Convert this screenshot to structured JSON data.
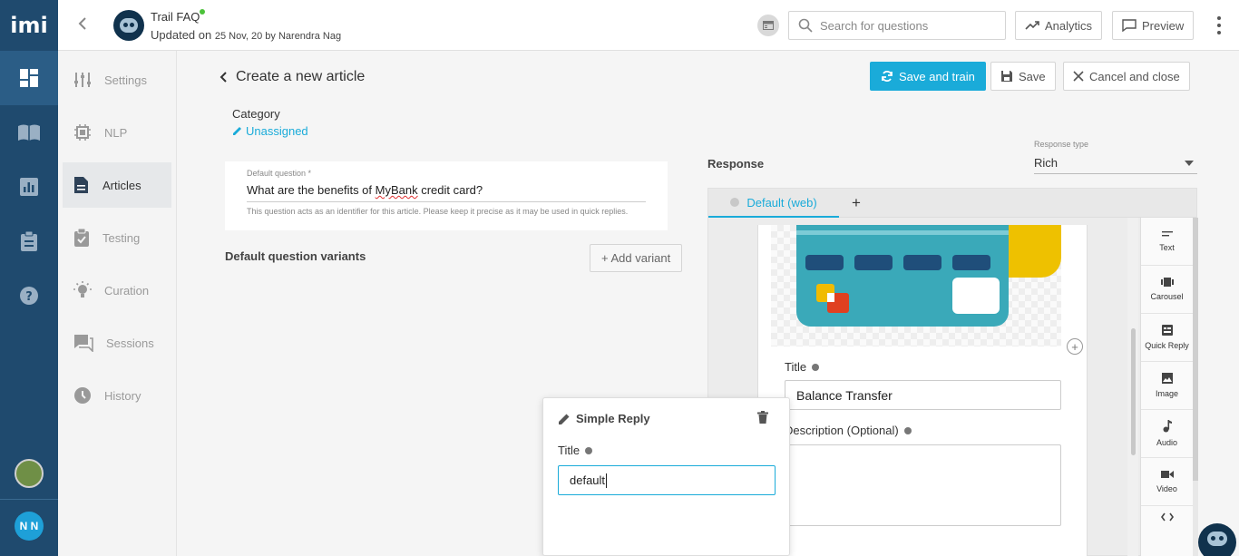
{
  "app": {
    "logo": "imi"
  },
  "header": {
    "bot_name": "Trail FAQ",
    "updated_prefix": "Updated on ",
    "updated_date": "25 Nov, 20",
    "updated_by": " by Narendra Nag",
    "search_placeholder": "Search for questions",
    "analytics_label": "Analytics",
    "preview_label": "Preview"
  },
  "rail": {
    "user_initials": "N N"
  },
  "subnav": {
    "items": [
      {
        "label": "Settings",
        "icon": "sliders-icon"
      },
      {
        "label": "NLP",
        "icon": "chip-icon"
      },
      {
        "label": "Articles",
        "icon": "document-icon"
      },
      {
        "label": "Testing",
        "icon": "clipboard-check-icon"
      },
      {
        "label": "Curation",
        "icon": "lightbulb-icon"
      },
      {
        "label": "Sessions",
        "icon": "chat-icon"
      },
      {
        "label": "History",
        "icon": "history-icon"
      }
    ],
    "active": "Articles"
  },
  "page": {
    "title": "Create a new article",
    "save_train_label": "Save and train",
    "save_label": "Save",
    "cancel_label": "Cancel and close",
    "category_label": "Category",
    "category_value": "Unassigned",
    "default_question_label": "Default question *",
    "default_question_pre": "What are the benefits of ",
    "default_question_misspelled": "MyBank",
    "default_question_post": " credit card?",
    "default_question_hint": "This question acts as an identifier for this article. Please keep it precise as it may be used in quick replies.",
    "variants_label": "Default question variants",
    "add_variant_label": "+ Add variant"
  },
  "response": {
    "label": "Response",
    "type_label": "Response type",
    "type_value": "Rich",
    "tab_label": "Default (web)",
    "add_tab": "+",
    "card_title_label": "Title",
    "card_title_value": "Balance Transfer",
    "card_desc_label": "Description (Optional)",
    "tools": [
      {
        "label": "Text",
        "icon": "text-icon"
      },
      {
        "label": "Carousel",
        "icon": "carousel-icon"
      },
      {
        "label": "Quick Reply",
        "icon": "quick-reply-icon"
      },
      {
        "label": "Image",
        "icon": "image-icon"
      },
      {
        "label": "Audio",
        "icon": "audio-icon"
      },
      {
        "label": "Video",
        "icon": "video-icon"
      },
      {
        "label": "",
        "icon": "code-icon"
      }
    ]
  },
  "popup": {
    "heading": "Simple Reply",
    "title_label": "Title",
    "title_value": "default"
  },
  "colors": {
    "accent": "#1aabd9",
    "rail": "#1f4a6e",
    "online": "#4cc23a"
  }
}
